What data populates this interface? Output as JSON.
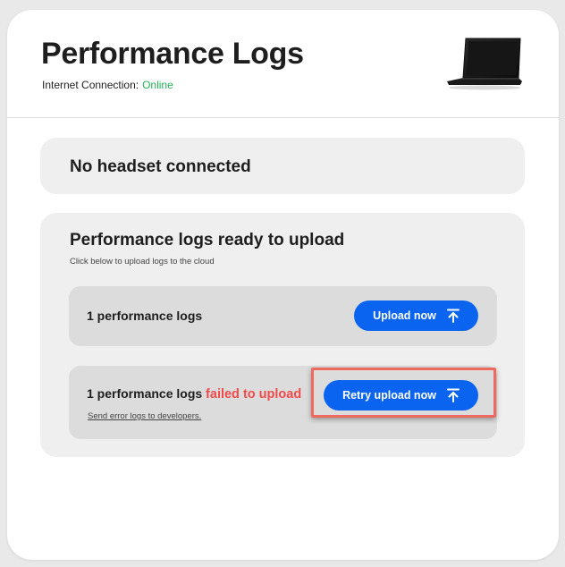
{
  "header": {
    "title": "Performance Logs",
    "connection_label": "Internet Connection:",
    "connection_status": "Online",
    "device_icon": "laptop-icon"
  },
  "headset": {
    "status": "No headset connected"
  },
  "logs": {
    "title": "Performance logs ready to upload",
    "subtitle": "Click below to upload logs to the cloud",
    "ready_row": {
      "label": "1 performance logs",
      "button_label": "Upload now",
      "button_icon": "upload-arrow-icon"
    },
    "failed_row": {
      "label": "1 performance logs",
      "failed_text": "failed to upload",
      "link_text": "Send error logs to developers.",
      "button_label": "Retry upload now",
      "button_icon": "upload-arrow-icon"
    }
  },
  "colors": {
    "accent": "#0a64f0",
    "online": "#23b257",
    "error": "#ef4b4b",
    "highlight": "#ee6a5e"
  }
}
